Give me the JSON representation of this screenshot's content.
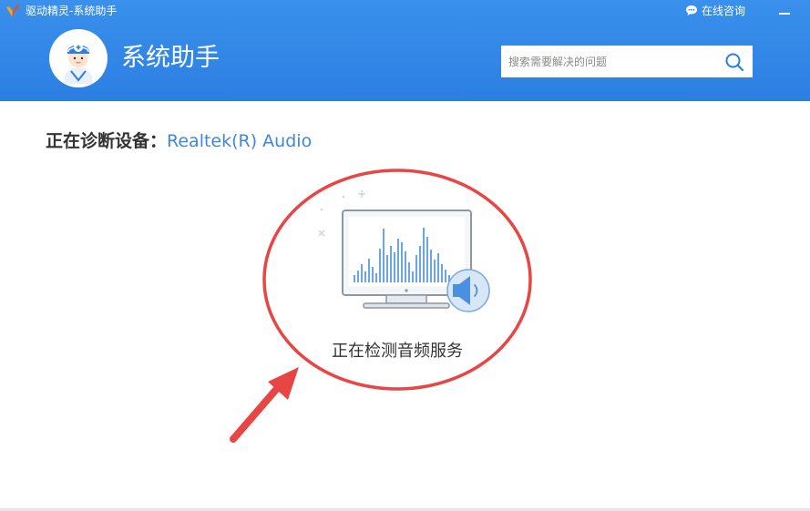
{
  "window": {
    "title": "驱动精灵-系统助手",
    "online_consult": "在线咨询"
  },
  "header": {
    "title": "系统助手",
    "search_placeholder": "搜索需要解决的问题"
  },
  "diagnosis": {
    "label": "正在诊断设备：",
    "device": "Realtek(R) Audio"
  },
  "status": {
    "text": "正在检测音频服务"
  },
  "colors": {
    "header_blue": "#2c7fe2",
    "link_blue": "#3f87d9",
    "annotation_red": "#e84545"
  },
  "icons": {
    "app": "driver-genius-logo-icon",
    "consult": "chat-bubble-icon",
    "minimize": "minimize-icon",
    "search": "search-icon",
    "avatar": "doctor-avatar-icon",
    "monitor": "monitor-waveform-icon",
    "speaker": "speaker-icon"
  }
}
